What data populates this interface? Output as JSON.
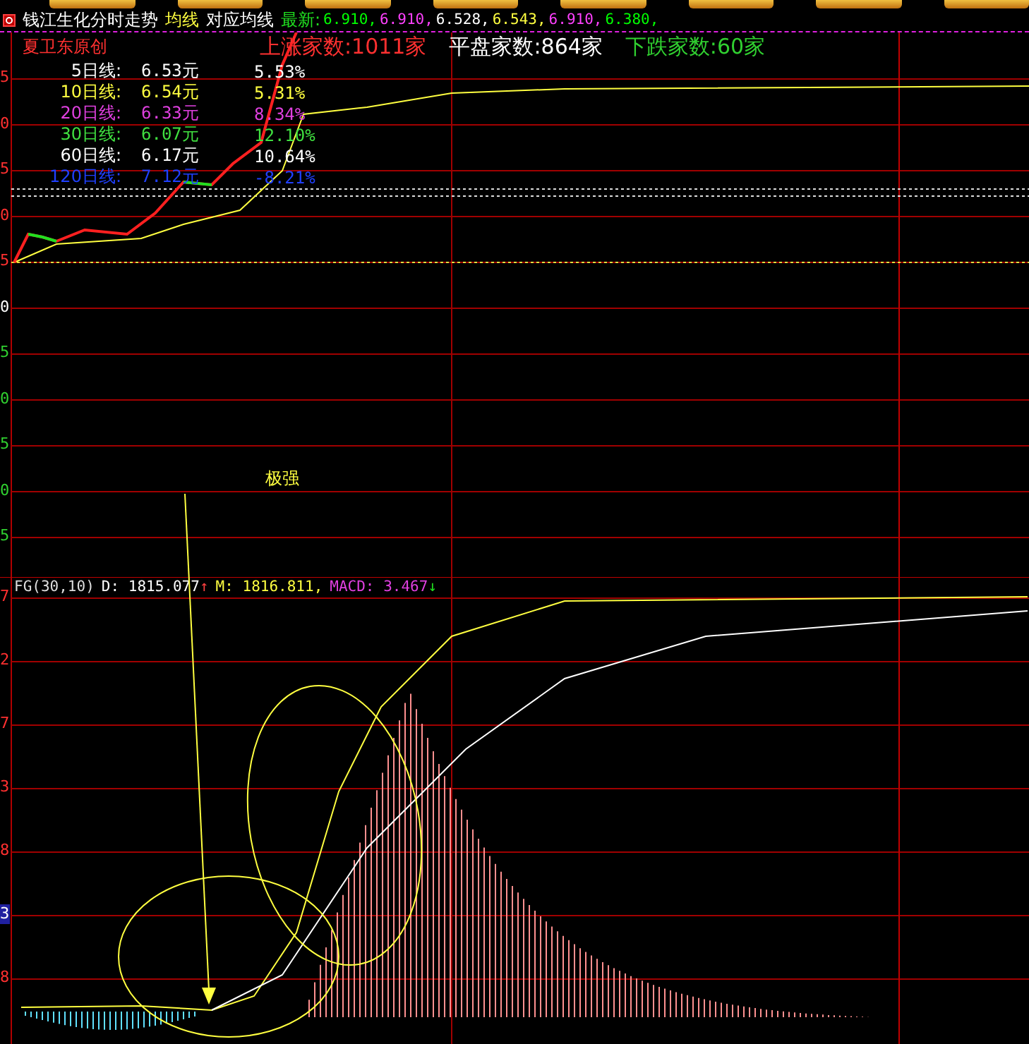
{
  "header": {
    "title": "钱江生化分时走势",
    "tag": "均线",
    "subtitle": "对应均线",
    "latest_label": "最新:",
    "latest_values": [
      {
        "text": "6.910,",
        "color": "#00ff00"
      },
      {
        "text": "6.910,",
        "color": "#ff40ff"
      },
      {
        "text": "6.528,",
        "color": "#ffffff"
      },
      {
        "text": "6.543,",
        "color": "#ffff40"
      },
      {
        "text": "6.910,",
        "color": "#ff40ff"
      },
      {
        "text": "6.380,",
        "color": "#00ff00"
      }
    ]
  },
  "author": "夏卫东原创",
  "market_stats": [
    {
      "text": "上涨家数:1011家",
      "color": "#ff3030"
    },
    {
      "text": "平盘家数:864家",
      "color": "#ffffff"
    },
    {
      "text": "下跌家数:60家",
      "color": "#30d030"
    }
  ],
  "ma_lines": [
    {
      "name": "5日线:",
      "price": "6.53元",
      "change": "5.53%",
      "color": "#ffffff"
    },
    {
      "name": "10日线:",
      "price": "6.54元",
      "change": "5.31%",
      "color": "#ffff40"
    },
    {
      "name": "20日线:",
      "price": "6.33元",
      "change": "8.34%",
      "color": "#e040e0"
    },
    {
      "name": "30日线:",
      "price": "6.07元",
      "change": "12.10%",
      "color": "#40e040"
    },
    {
      "name": "60日线:",
      "price": "6.17元",
      "change": "10.64%",
      "color": "#ffffff"
    },
    {
      "name": "120日线:",
      "price": "7.12元",
      "change": "-8.21%",
      "color": "#2040ff"
    }
  ],
  "price_axis": [
    {
      "text": "5",
      "kind": "up"
    },
    {
      "text": "0",
      "kind": "up"
    },
    {
      "text": "5",
      "kind": "up"
    },
    {
      "text": "0",
      "kind": "up"
    },
    {
      "text": "5",
      "kind": "up"
    },
    {
      "text": "0",
      "kind": "flat"
    },
    {
      "text": "5",
      "kind": "down"
    },
    {
      "text": "0",
      "kind": "down"
    },
    {
      "text": "5",
      "kind": "down"
    },
    {
      "text": "0",
      "kind": "down"
    },
    {
      "text": "5",
      "kind": "down"
    }
  ],
  "annotation": "极强",
  "indicator": {
    "name": "FG(30,10)",
    "d": "D: 1815.077",
    "d_arrow": "↑",
    "m": "M: 1816.811,",
    "macd": "MACD: 3.467",
    "macd_arrow": "↓"
  },
  "indicator_axis": [
    {
      "text": "7",
      "selected": false
    },
    {
      "text": "2",
      "selected": false
    },
    {
      "text": "7",
      "selected": false
    },
    {
      "text": "3",
      "selected": false
    },
    {
      "text": "8",
      "selected": false
    },
    {
      "text": "3",
      "selected": true
    },
    {
      "text": "8",
      "selected": false
    }
  ]
}
